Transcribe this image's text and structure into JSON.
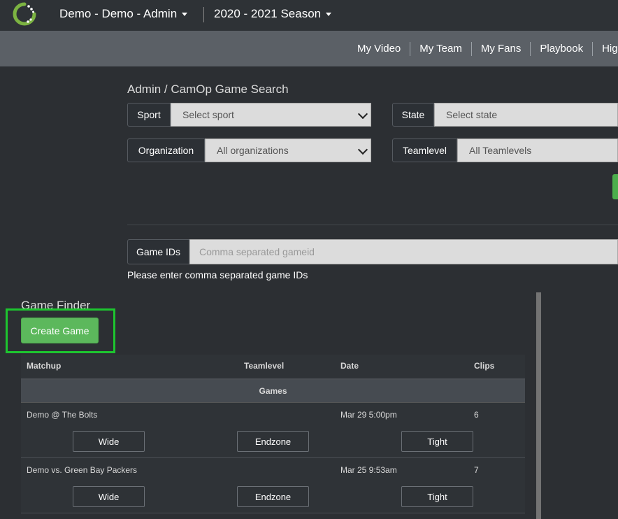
{
  "header": {
    "brand": "Demo - Demo - Admin",
    "season": "2020 - 2021 Season"
  },
  "nav": [
    "My Video",
    "My Team",
    "My Fans",
    "Playbook",
    "Hig"
  ],
  "search": {
    "title": "Admin / CamOp Game Search",
    "sport_label": "Sport",
    "sport_value": "Select sport",
    "state_label": "State",
    "state_value": "Select state",
    "org_label": "Organization",
    "org_value": "All organizations",
    "teamlevel_label": "Teamlevel",
    "teamlevel_value": "All Teamlevels",
    "gameids_label": "Game IDs",
    "gameids_placeholder": "Comma separated gameid",
    "helper": "Please enter comma separated game IDs"
  },
  "finder": {
    "title": "Game Finder",
    "create_label": "Create Game",
    "columns": [
      "Matchup",
      "Teamlevel",
      "Date",
      "Clips"
    ],
    "group_label": "Games",
    "rows": [
      {
        "matchup": "Demo @ The Bolts",
        "teamlevel": "",
        "date": "Mar 29 5:00pm",
        "clips": "6",
        "buttons": [
          "Wide",
          "Endzone",
          "Tight"
        ]
      },
      {
        "matchup": "Demo vs. Green Bay Packers",
        "teamlevel": "",
        "date": "Mar 25 9:53am",
        "clips": "7",
        "buttons": [
          "Wide",
          "Endzone",
          "Tight"
        ]
      }
    ]
  },
  "colors": {
    "accent_green": "#5cb85c",
    "highlight_green": "#1dc52f"
  }
}
